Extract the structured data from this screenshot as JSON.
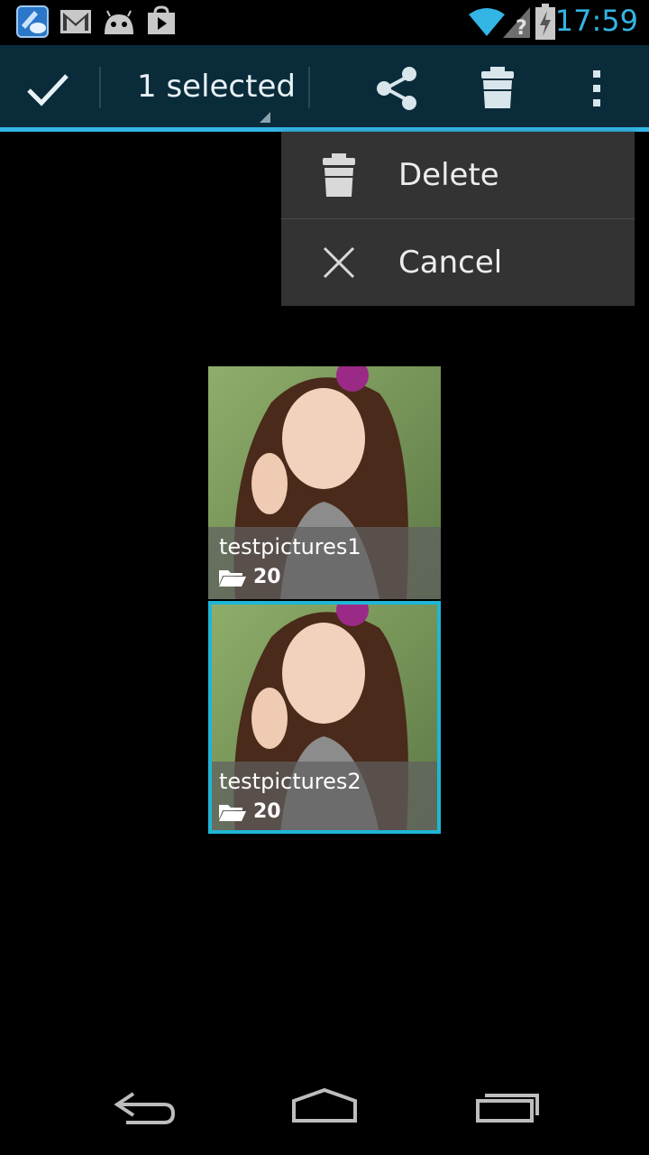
{
  "status_bar": {
    "time": "17:59",
    "icons": [
      "intel-app-icon",
      "gmail-icon",
      "android-icon",
      "play-store-icon",
      "wifi-icon",
      "signal-unknown-icon",
      "battery-charging-icon"
    ],
    "accent": "#33b5e5"
  },
  "action_bar": {
    "title": "1 selected",
    "buttons": [
      "done-check-icon",
      "share-icon",
      "trash-icon",
      "overflow-menu-icon"
    ],
    "bg": "#0a2b3a"
  },
  "menu": {
    "items": [
      {
        "label": "Delete",
        "icon": "trash-icon"
      },
      {
        "label": "Cancel",
        "icon": "close-icon"
      }
    ]
  },
  "albums": [
    {
      "name": "testpictures1",
      "count": "20",
      "selected": false
    },
    {
      "name": "testpictures2",
      "count": "20",
      "selected": true
    }
  ],
  "nav_bar": {
    "buttons": [
      "back-icon",
      "home-icon",
      "recent-apps-icon"
    ]
  }
}
